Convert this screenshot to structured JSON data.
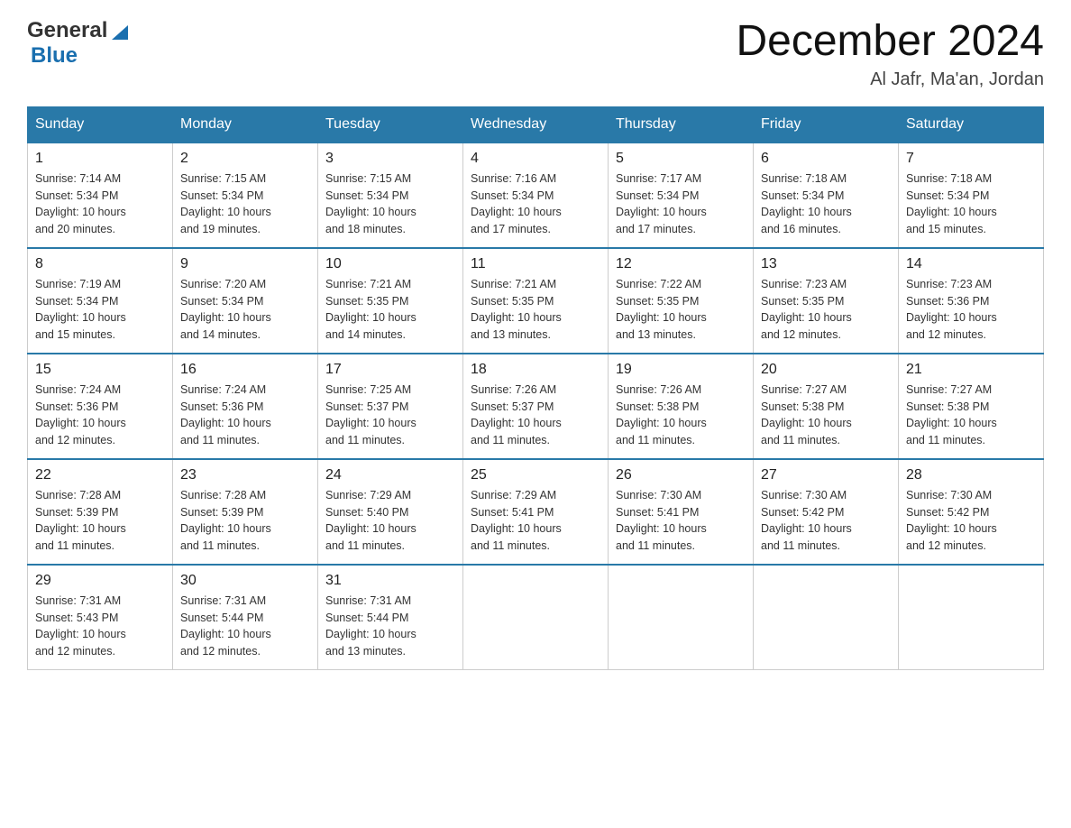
{
  "header": {
    "logo_general": "General",
    "logo_blue": "Blue",
    "month_title": "December 2024",
    "location": "Al Jafr, Ma'an, Jordan"
  },
  "calendar": {
    "days": [
      "Sunday",
      "Monday",
      "Tuesday",
      "Wednesday",
      "Thursday",
      "Friday",
      "Saturday"
    ],
    "weeks": [
      [
        {
          "date": "1",
          "sunrise": "7:14 AM",
          "sunset": "5:34 PM",
          "daylight": "10 hours and 20 minutes."
        },
        {
          "date": "2",
          "sunrise": "7:15 AM",
          "sunset": "5:34 PM",
          "daylight": "10 hours and 19 minutes."
        },
        {
          "date": "3",
          "sunrise": "7:15 AM",
          "sunset": "5:34 PM",
          "daylight": "10 hours and 18 minutes."
        },
        {
          "date": "4",
          "sunrise": "7:16 AM",
          "sunset": "5:34 PM",
          "daylight": "10 hours and 17 minutes."
        },
        {
          "date": "5",
          "sunrise": "7:17 AM",
          "sunset": "5:34 PM",
          "daylight": "10 hours and 17 minutes."
        },
        {
          "date": "6",
          "sunrise": "7:18 AM",
          "sunset": "5:34 PM",
          "daylight": "10 hours and 16 minutes."
        },
        {
          "date": "7",
          "sunrise": "7:18 AM",
          "sunset": "5:34 PM",
          "daylight": "10 hours and 15 minutes."
        }
      ],
      [
        {
          "date": "8",
          "sunrise": "7:19 AM",
          "sunset": "5:34 PM",
          "daylight": "10 hours and 15 minutes."
        },
        {
          "date": "9",
          "sunrise": "7:20 AM",
          "sunset": "5:34 PM",
          "daylight": "10 hours and 14 minutes."
        },
        {
          "date": "10",
          "sunrise": "7:21 AM",
          "sunset": "5:35 PM",
          "daylight": "10 hours and 14 minutes."
        },
        {
          "date": "11",
          "sunrise": "7:21 AM",
          "sunset": "5:35 PM",
          "daylight": "10 hours and 13 minutes."
        },
        {
          "date": "12",
          "sunrise": "7:22 AM",
          "sunset": "5:35 PM",
          "daylight": "10 hours and 13 minutes."
        },
        {
          "date": "13",
          "sunrise": "7:23 AM",
          "sunset": "5:35 PM",
          "daylight": "10 hours and 12 minutes."
        },
        {
          "date": "14",
          "sunrise": "7:23 AM",
          "sunset": "5:36 PM",
          "daylight": "10 hours and 12 minutes."
        }
      ],
      [
        {
          "date": "15",
          "sunrise": "7:24 AM",
          "sunset": "5:36 PM",
          "daylight": "10 hours and 12 minutes."
        },
        {
          "date": "16",
          "sunrise": "7:24 AM",
          "sunset": "5:36 PM",
          "daylight": "10 hours and 11 minutes."
        },
        {
          "date": "17",
          "sunrise": "7:25 AM",
          "sunset": "5:37 PM",
          "daylight": "10 hours and 11 minutes."
        },
        {
          "date": "18",
          "sunrise": "7:26 AM",
          "sunset": "5:37 PM",
          "daylight": "10 hours and 11 minutes."
        },
        {
          "date": "19",
          "sunrise": "7:26 AM",
          "sunset": "5:38 PM",
          "daylight": "10 hours and 11 minutes."
        },
        {
          "date": "20",
          "sunrise": "7:27 AM",
          "sunset": "5:38 PM",
          "daylight": "10 hours and 11 minutes."
        },
        {
          "date": "21",
          "sunrise": "7:27 AM",
          "sunset": "5:38 PM",
          "daylight": "10 hours and 11 minutes."
        }
      ],
      [
        {
          "date": "22",
          "sunrise": "7:28 AM",
          "sunset": "5:39 PM",
          "daylight": "10 hours and 11 minutes."
        },
        {
          "date": "23",
          "sunrise": "7:28 AM",
          "sunset": "5:39 PM",
          "daylight": "10 hours and 11 minutes."
        },
        {
          "date": "24",
          "sunrise": "7:29 AM",
          "sunset": "5:40 PM",
          "daylight": "10 hours and 11 minutes."
        },
        {
          "date": "25",
          "sunrise": "7:29 AM",
          "sunset": "5:41 PM",
          "daylight": "10 hours and 11 minutes."
        },
        {
          "date": "26",
          "sunrise": "7:30 AM",
          "sunset": "5:41 PM",
          "daylight": "10 hours and 11 minutes."
        },
        {
          "date": "27",
          "sunrise": "7:30 AM",
          "sunset": "5:42 PM",
          "daylight": "10 hours and 11 minutes."
        },
        {
          "date": "28",
          "sunrise": "7:30 AM",
          "sunset": "5:42 PM",
          "daylight": "10 hours and 12 minutes."
        }
      ],
      [
        {
          "date": "29",
          "sunrise": "7:31 AM",
          "sunset": "5:43 PM",
          "daylight": "10 hours and 12 minutes."
        },
        {
          "date": "30",
          "sunrise": "7:31 AM",
          "sunset": "5:44 PM",
          "daylight": "10 hours and 12 minutes."
        },
        {
          "date": "31",
          "sunrise": "7:31 AM",
          "sunset": "5:44 PM",
          "daylight": "10 hours and 13 minutes."
        },
        null,
        null,
        null,
        null
      ]
    ],
    "labels": {
      "sunrise": "Sunrise:",
      "sunset": "Sunset:",
      "daylight": "Daylight:"
    }
  }
}
